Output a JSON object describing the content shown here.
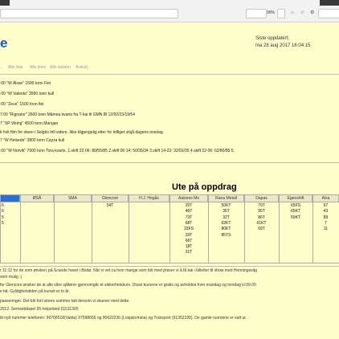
{
  "browser": {
    "zoom": "90%"
  },
  "header": {
    "logo": "e",
    "nav": [
      "...",
      "Alle liste",
      "Alle linnn",
      "Alle lastebn",
      "Avslutt"
    ],
    "updated_label": "Siste oppdatert:",
    "updated_value": "ma 28 aug 2017 16:04:15"
  },
  "ships": [
    ":00 \"W Alsse\" 1500 tonn Fiei",
    ":00 \"W Valenta\" 3990 tonn kull",
    ":00 \"Zeus\" 1500 tonn fiei",
    "7:00 \"Rignator\" 2600 tonn Mâmea kvarts fra T-kai til GMN Bl 12/92/23/19/54",
    "7 \"SP Viking\" 4500 tonn Mangan",
    "k hvit film for steen i Selgtio trill videre. Ikke tilgjengelig etter for tidliget utsjå dagens onsdag.",
    "7 \"W Helsedo\" 3800 tonn Cayza kull",
    ":00 \"W Norvik\" 7600 tonn Tora kvarts. 1.skift 22-06: 80/55/85 2.skift 06-14: 50/35/34 3.skift 14-22: 32/50/35 4.skift 22-06: 62/80/85 5."
  ],
  "table": {
    "title": "Ute på oppdrag",
    "accent_color": "#2f6fd0",
    "columns": [
      {
        "label": "",
        "values": [
          "6",
          "6",
          "5",
          "5"
        ]
      },
      {
        "label": "ØSÅ",
        "values": []
      },
      {
        "label": "SMA",
        "values": []
      },
      {
        "label": "Glencore",
        "values": [
          "54T"
        ]
      },
      {
        "label": "H.J. Hogås",
        "values": []
      },
      {
        "label": "Aalsnes Mo",
        "values": [
          "20T",
          "46T",
          "73T",
          "68T",
          "33FS",
          "33T",
          "66T",
          "18T",
          "31T"
        ]
      },
      {
        "label": "Rana Metall",
        "values": [
          "50KT",
          "35T",
          "32T",
          "62KT",
          "80KT",
          "85TS"
        ]
      },
      {
        "label": "Dapas",
        "values": [
          "70T",
          "95T",
          "86T",
          "61KT",
          "69T"
        ]
      },
      {
        "label": "Egenshift",
        "values": [
          "65FS",
          "65KT",
          "59KT"
        ]
      },
      {
        "label": "Alsa",
        "values": [
          "67",
          "43",
          "89",
          "7",
          "11"
        ]
      }
    ]
  },
  "notes": [
    "r 11:12 for de som ønsker) på Scande havet i Bodø. Når vi vet ca hvor mange som blir med prøver vi å få tak i billetter til show med Honningsvåg",
    "som mulig :)",
    "for Glencore ønsker de at alle våre sjåfører gjennomgår et sikkerhetskurs. Disse kursene er gratis og avholdes hver mandag og torsdag kl 09.00",
    "e tid. Gyldighetstiden på kurset er to år.",
    "passeringer. Det blir fort stores summer tatt dersom vi skurver med dette.",
    "2012. Semsebåspel 65 helpeland 61511305",
    "itt nytt nummer telefonen: 90768518(Vakta) 97598656 og 90622236 (Losjalormina) og Transport (91352195). De gamle numrene er satt ut."
  ]
}
